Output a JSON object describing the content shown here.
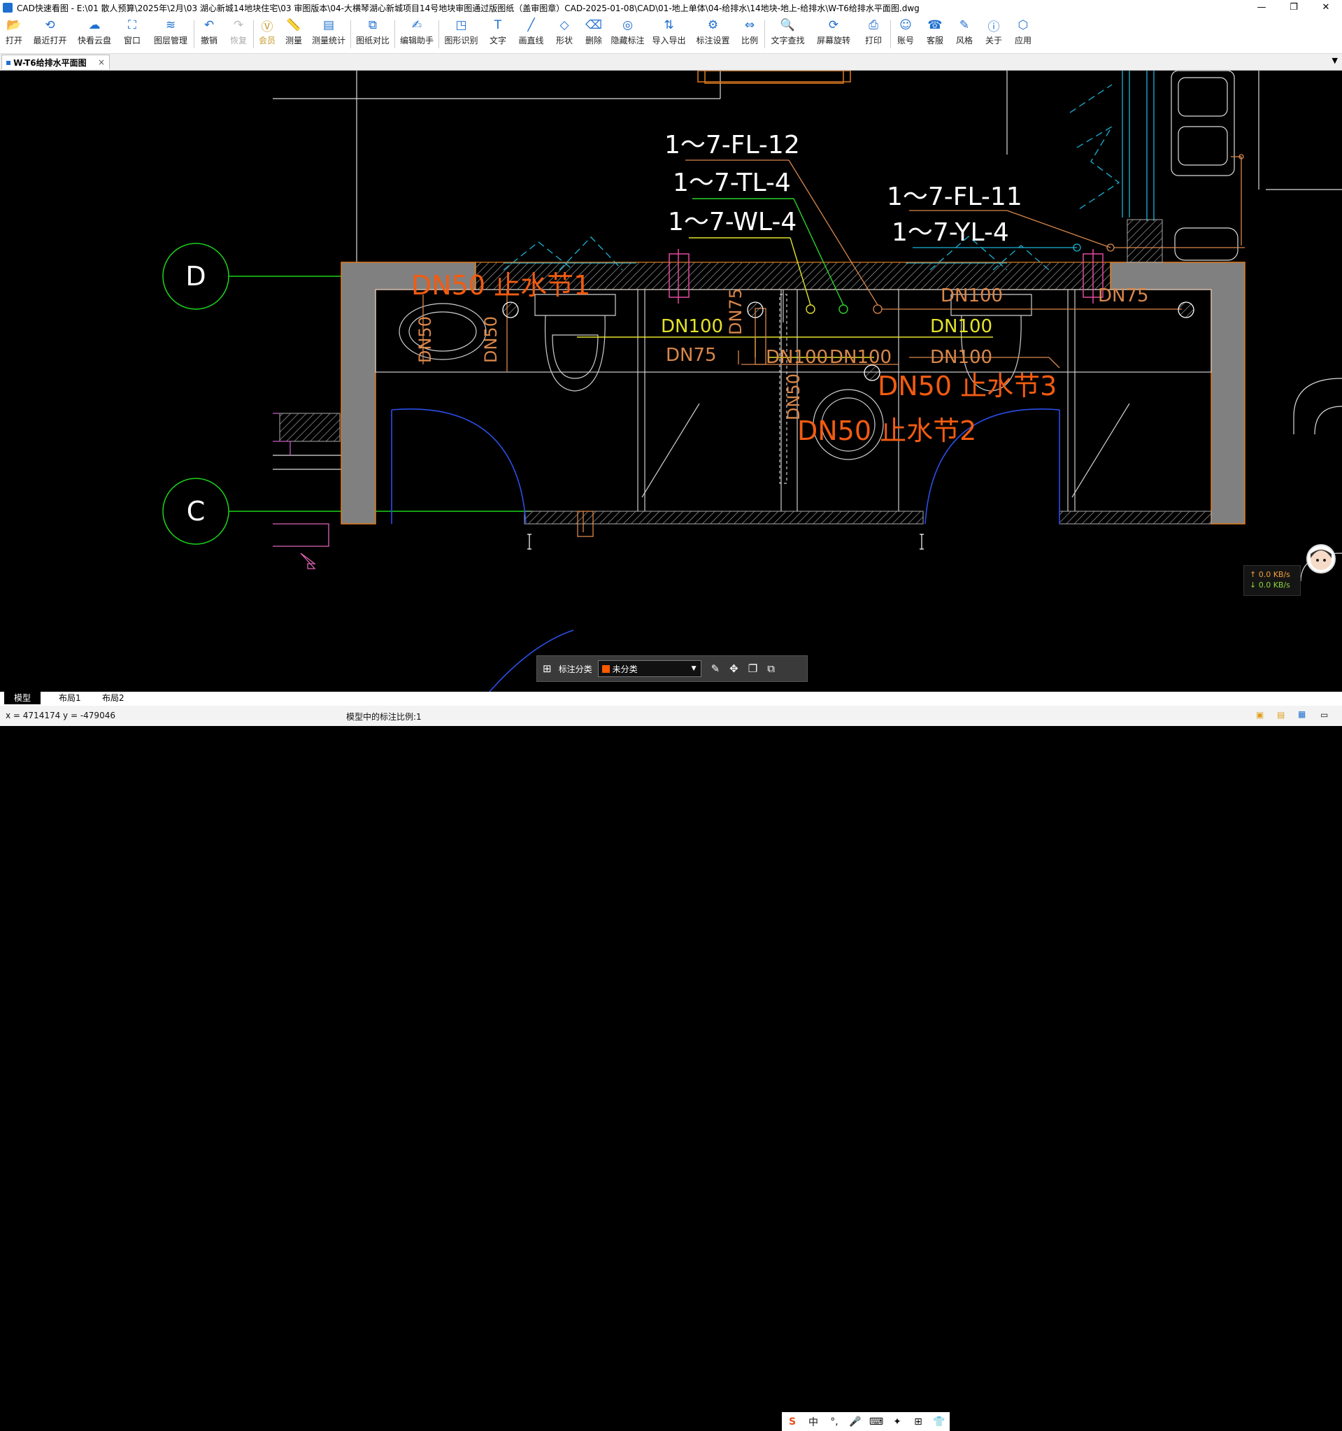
{
  "window": {
    "title": "CAD快速看图 - E:\\01 散人预算\\2025年\\2月\\03 湖心新城14地块住宅\\03 审图版本\\04-大横琴湖心新城项目14号地块审图通过版图纸（盖审图章）CAD-2025-01-08\\CAD\\01-地上单体\\04-给排水\\14地块-地上-给排水\\W-T6给排水平面图.dwg",
    "minimize": "—",
    "maximize": "❐",
    "close": "✕"
  },
  "toolbar": {
    "items": [
      {
        "label": "打开",
        "icon": "folder-open-icon"
      },
      {
        "label": "最近打开",
        "icon": "recent-icon"
      },
      {
        "label": "快看云盘",
        "icon": "cloud-icon"
      },
      {
        "label": "窗口",
        "icon": "window-icon"
      },
      {
        "label": "图层管理",
        "icon": "layers-icon"
      },
      {
        "label": "撤销",
        "icon": "undo-icon"
      },
      {
        "label": "恢复",
        "icon": "redo-icon"
      },
      {
        "label": "会员",
        "icon": "vip-icon"
      },
      {
        "label": "测量",
        "icon": "ruler-icon"
      },
      {
        "label": "测量统计",
        "icon": "measure-stats-icon"
      },
      {
        "label": "图纸对比",
        "icon": "compare-icon"
      },
      {
        "label": "编辑助手",
        "icon": "edit-assistant-icon"
      },
      {
        "label": "图形识别",
        "icon": "shape-recognize-icon"
      },
      {
        "label": "文字",
        "icon": "text-icon"
      },
      {
        "label": "画直线",
        "icon": "line-icon"
      },
      {
        "label": "形状",
        "icon": "shape-icon"
      },
      {
        "label": "删除",
        "icon": "eraser-icon"
      },
      {
        "label": "隐藏标注",
        "icon": "hide-annotation-icon"
      },
      {
        "label": "导入导出",
        "icon": "import-export-icon"
      },
      {
        "label": "标注设置",
        "icon": "annotation-settings-icon"
      },
      {
        "label": "比例",
        "icon": "scale-icon"
      },
      {
        "label": "文字查找",
        "icon": "text-search-icon"
      },
      {
        "label": "屏幕旋转",
        "icon": "rotate-screen-icon"
      },
      {
        "label": "打印",
        "icon": "print-icon"
      },
      {
        "label": "账号",
        "icon": "account-icon"
      },
      {
        "label": "客服",
        "icon": "support-icon"
      },
      {
        "label": "风格",
        "icon": "style-icon"
      },
      {
        "label": "关于",
        "icon": "info-icon"
      },
      {
        "label": "应用",
        "icon": "apps-icon"
      }
    ]
  },
  "doc_tab": {
    "label": "W-T6给排水平面图",
    "close": "×"
  },
  "drawing": {
    "grid_d": "D",
    "grid_c": "C",
    "labels": {
      "fl12": "1～7-FL-12",
      "tl4": "1～7-TL-4",
      "wl4": "1～7-WL-4",
      "fl11": "1～7-FL-11",
      "yl4": "1～7-YL-4",
      "stop1": "DN50 止水节1",
      "stop2": "DN50 止水节2",
      "stop3": "DN50 止水节3",
      "dn100_a": "DN100",
      "dn75_a": "DN75",
      "dn75_b": "DN75",
      "dn100_b": "DN100",
      "dn100_c": "DN100",
      "dn100_d": "DN100",
      "dn100_e": "DN100",
      "dn100_f": "DN100",
      "dn75_c": "DN75",
      "dn50_a": "DN50",
      "dn50_b": "DN50",
      "dn50_c": "DN50"
    }
  },
  "annotation_bar": {
    "label": "标注分类",
    "category": "未分类",
    "category_color": "#ff5a00"
  },
  "layout_tabs": [
    "模型",
    "布局1",
    "布局2"
  ],
  "status": {
    "coords": "x = 4714174  y = -479046",
    "scale": "模型中的标注比例:1"
  },
  "network": {
    "up": "↑ 0.0 KB/s",
    "down": "↓ 0.0 KB/s"
  },
  "ime": [
    "S",
    "中",
    "°,",
    "🎤",
    "⌨",
    "✦",
    "⊞",
    "👕"
  ]
}
